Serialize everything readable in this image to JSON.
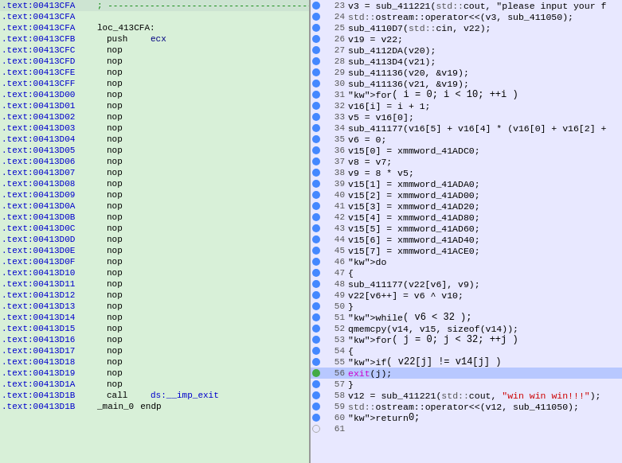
{
  "left": {
    "rows": [
      {
        "addr": ".text:00413CFA",
        "comment": "; -------------------------------------------------",
        "type": "comment"
      },
      {
        "addr": ".text:00413CFA",
        "label": "",
        "type": "blank"
      },
      {
        "addr": ".text:00413CFA",
        "label": "loc_413CFA:",
        "type": "label"
      },
      {
        "addr": ".text:00413CFB",
        "mnemonic": "push",
        "operand": "ecx",
        "type": "instr"
      },
      {
        "addr": ".text:00413CFC",
        "mnemonic": "nop",
        "type": "instr"
      },
      {
        "addr": ".text:00413CFD",
        "mnemonic": "nop",
        "type": "instr"
      },
      {
        "addr": ".text:00413CFE",
        "mnemonic": "nop",
        "type": "instr"
      },
      {
        "addr": ".text:00413CFF",
        "mnemonic": "nop",
        "type": "instr"
      },
      {
        "addr": ".text:00413D00",
        "mnemonic": "nop",
        "type": "instr"
      },
      {
        "addr": ".text:00413D01",
        "mnemonic": "nop",
        "type": "instr"
      },
      {
        "addr": ".text:00413D02",
        "mnemonic": "nop",
        "type": "instr"
      },
      {
        "addr": ".text:00413D03",
        "mnemonic": "nop",
        "type": "instr"
      },
      {
        "addr": ".text:00413D04",
        "mnemonic": "nop",
        "type": "instr"
      },
      {
        "addr": ".text:00413D05",
        "mnemonic": "nop",
        "type": "instr"
      },
      {
        "addr": ".text:00413D06",
        "mnemonic": "nop",
        "type": "instr"
      },
      {
        "addr": ".text:00413D07",
        "mnemonic": "nop",
        "type": "instr"
      },
      {
        "addr": ".text:00413D08",
        "mnemonic": "nop",
        "type": "instr"
      },
      {
        "addr": ".text:00413D09",
        "mnemonic": "nop",
        "type": "instr"
      },
      {
        "addr": ".text:00413D0A",
        "mnemonic": "nop",
        "type": "instr"
      },
      {
        "addr": ".text:00413D0B",
        "mnemonic": "nop",
        "type": "instr"
      },
      {
        "addr": ".text:00413D0C",
        "mnemonic": "nop",
        "type": "instr"
      },
      {
        "addr": ".text:00413D0D",
        "mnemonic": "nop",
        "type": "instr"
      },
      {
        "addr": ".text:00413D0E",
        "mnemonic": "nop",
        "type": "instr"
      },
      {
        "addr": ".text:00413D0F",
        "mnemonic": "nop",
        "type": "instr"
      },
      {
        "addr": ".text:00413D10",
        "mnemonic": "nop",
        "type": "instr"
      },
      {
        "addr": ".text:00413D11",
        "mnemonic": "nop",
        "type": "instr"
      },
      {
        "addr": ".text:00413D12",
        "mnemonic": "nop",
        "type": "instr"
      },
      {
        "addr": ".text:00413D13",
        "mnemonic": "nop",
        "type": "instr"
      },
      {
        "addr": ".text:00413D14",
        "mnemonic": "nop",
        "type": "instr"
      },
      {
        "addr": ".text:00413D15",
        "mnemonic": "nop",
        "type": "instr"
      },
      {
        "addr": ".text:00413D16",
        "mnemonic": "nop",
        "type": "instr"
      },
      {
        "addr": ".text:00413D17",
        "mnemonic": "nop",
        "type": "instr"
      },
      {
        "addr": ".text:00413D18",
        "mnemonic": "nop",
        "type": "instr"
      },
      {
        "addr": ".text:00413D19",
        "mnemonic": "nop",
        "type": "instr"
      },
      {
        "addr": ".text:00413D1A",
        "mnemonic": "nop",
        "type": "instr"
      },
      {
        "addr": ".text:00413D1B",
        "mnemonic": "call",
        "operand": "ds:__imp_exit",
        "operand_color": "special",
        "type": "instr"
      },
      {
        "addr": ".text:00413D1B",
        "label": "_main_0",
        "mnemonic": "endp",
        "type": "label_endp"
      }
    ]
  },
  "right": {
    "rows": [
      {
        "line": 23,
        "dot": "blue",
        "code": "v3 = sub_411221(std::cout, \"please input your f",
        "highlight": false
      },
      {
        "line": 24,
        "dot": "blue",
        "code": "std::ostream::operator<<(v3, sub_411050);",
        "highlight": false
      },
      {
        "line": 25,
        "dot": "blue",
        "code": "sub_4110D7(std::cin, v22);",
        "highlight": false
      },
      {
        "line": 26,
        "dot": "blue",
        "code": "v19 = v22;",
        "highlight": false
      },
      {
        "line": 27,
        "dot": "blue",
        "code": "sub_4112DA(v20);",
        "highlight": false
      },
      {
        "line": 28,
        "dot": "blue",
        "code": "sub_4113D4(v21);",
        "highlight": false
      },
      {
        "line": 29,
        "dot": "blue",
        "code": "sub_411136(v20, &v19);",
        "highlight": false
      },
      {
        "line": 30,
        "dot": "blue",
        "code": "sub_411136(v21, &v19);",
        "highlight": false
      },
      {
        "line": 31,
        "dot": "blue",
        "code": "for ( i = 0; i < 10; ++i )",
        "highlight": false
      },
      {
        "line": 32,
        "dot": "blue",
        "code": "  v16[i] = i + 1;",
        "highlight": false
      },
      {
        "line": 33,
        "dot": "blue",
        "code": "v5 = v16[0];",
        "highlight": false
      },
      {
        "line": 34,
        "dot": "blue",
        "code": "sub_411177(v16[5] + v16[4] * (v16[0] + v16[2] +",
        "highlight": false
      },
      {
        "line": 35,
        "dot": "blue",
        "code": "v6 = 0;",
        "highlight": false
      },
      {
        "line": 36,
        "dot": "blue",
        "code": "v15[0] = xmmword_41ADC0;",
        "highlight": false
      },
      {
        "line": 37,
        "dot": "blue",
        "code": "v8 = v7;",
        "highlight": false
      },
      {
        "line": 38,
        "dot": "blue",
        "code": "v9 = 8 * v5;",
        "highlight": false
      },
      {
        "line": 39,
        "dot": "blue",
        "code": "v15[1] = xmmword_41ADA0;",
        "highlight": false
      },
      {
        "line": 40,
        "dot": "blue",
        "code": "v15[2] = xmmword_41AD00;",
        "highlight": false
      },
      {
        "line": 41,
        "dot": "blue",
        "code": "v15[3] = xmmword_41AD20;",
        "highlight": false
      },
      {
        "line": 42,
        "dot": "blue",
        "code": "v15[4] = xmmword_41AD80;",
        "highlight": false
      },
      {
        "line": 43,
        "dot": "blue",
        "code": "v15[5] = xmmword_41AD60;",
        "highlight": false
      },
      {
        "line": 44,
        "dot": "blue",
        "code": "v15[6] = xmmword_41AD40;",
        "highlight": false
      },
      {
        "line": 45,
        "dot": "blue",
        "code": "v15[7] = xmmword_41ACE0;",
        "highlight": false
      },
      {
        "line": 46,
        "dot": "blue",
        "code": "do",
        "highlight": false
      },
      {
        "line": 47,
        "dot": "blue",
        "code": "{",
        "highlight": false
      },
      {
        "line": 48,
        "dot": "blue",
        "code": "  sub_411177(v22[v6], v9);",
        "highlight": false
      },
      {
        "line": 49,
        "dot": "blue",
        "code": "  v22[v6++] = v6 ^ v10;",
        "highlight": false
      },
      {
        "line": 50,
        "dot": "blue",
        "code": "}",
        "highlight": false
      },
      {
        "line": 51,
        "dot": "blue",
        "code": "while ( v6 < 32 );",
        "highlight": false
      },
      {
        "line": 52,
        "dot": "blue",
        "code": "qmemcpy(v14, v15, sizeof(v14));",
        "highlight": false
      },
      {
        "line": 53,
        "dot": "blue",
        "code": "for ( j = 0; j < 32; ++j )",
        "highlight": false
      },
      {
        "line": 54,
        "dot": "blue",
        "code": "{",
        "highlight": false
      },
      {
        "line": 55,
        "dot": "blue",
        "code": "  if ( v22[j] != v14[j] )",
        "highlight": false
      },
      {
        "line": 56,
        "dot": "green",
        "code": "    exit(j);",
        "highlight": true
      },
      {
        "line": 57,
        "dot": "blue",
        "code": "}",
        "highlight": false
      },
      {
        "line": 58,
        "dot": "blue",
        "code": "v12 = sub_411221(std::cout, \"win win win!!!\");",
        "highlight": false
      },
      {
        "line": 59,
        "dot": "blue",
        "code": "std::ostream::operator<<(v12, sub_411050);",
        "highlight": false
      },
      {
        "line": 60,
        "dot": "blue",
        "code": "return 0;",
        "highlight": false
      },
      {
        "line": 61,
        "dot": "empty",
        "code": "",
        "highlight": false
      }
    ]
  }
}
